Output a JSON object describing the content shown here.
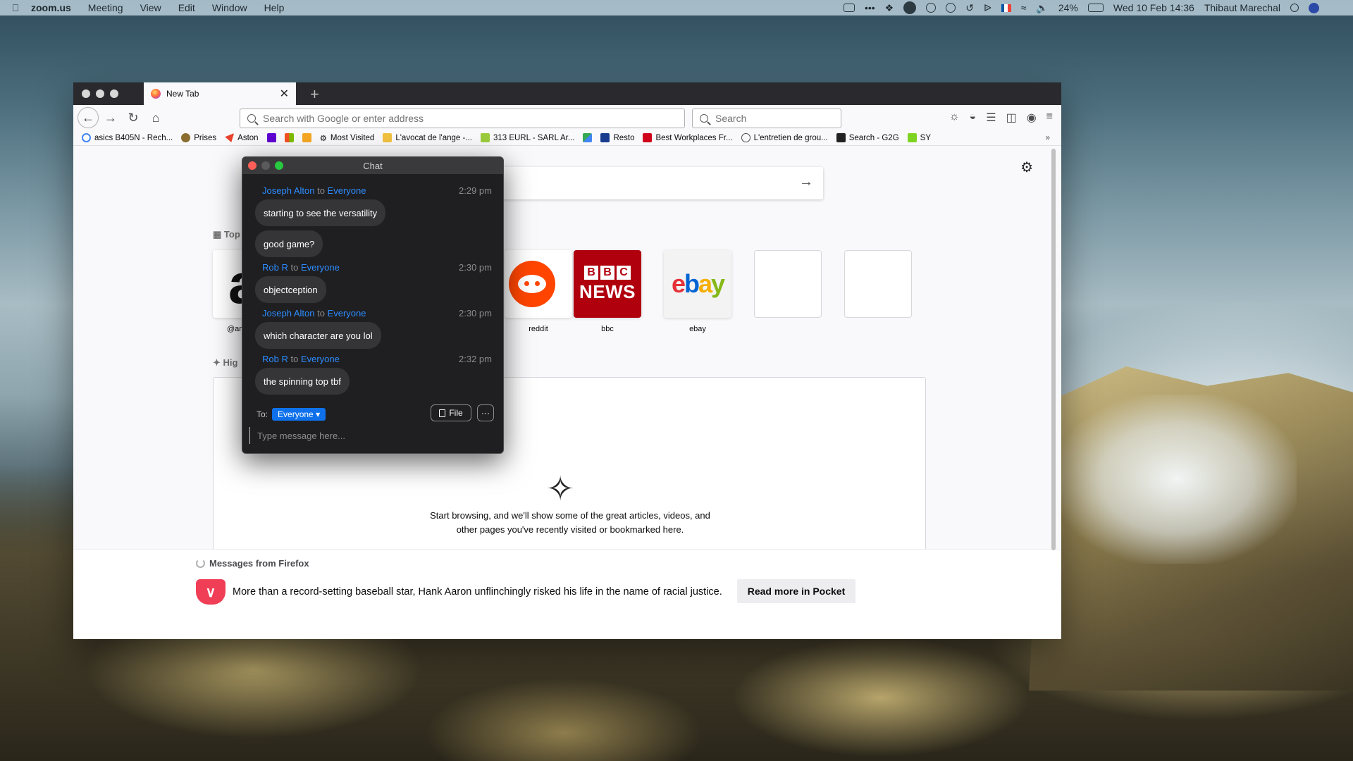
{
  "menubar": {
    "app": "zoom.us",
    "items": [
      "Meeting",
      "View",
      "Edit",
      "Window",
      "Help"
    ],
    "battery": "24%",
    "datetime": "Wed 10 Feb  14:36",
    "user": "Thibaut Marechal"
  },
  "firefox": {
    "tab_title": "New Tab",
    "url_placeholder": "Search with Google or enter address",
    "search_placeholder": "Search",
    "bookmarks": [
      {
        "label": "asics B405N - Rech...",
        "color": "#4285f4"
      },
      {
        "label": "Prises",
        "color": "#8a6d2f"
      },
      {
        "label": "Aston",
        "color": "#e8432d"
      },
      {
        "label": "",
        "color": "#5f01d1"
      },
      {
        "label": "",
        "color": "#f25022"
      },
      {
        "label": "",
        "color": "#f5a623"
      },
      {
        "label": "Most Visited",
        "color": "#4a4a4f"
      },
      {
        "label": "L'avocat de l'ange -...",
        "color": "#f0c040"
      },
      {
        "label": "313 EURL - SARL Ar...",
        "color": "#9ccc3c"
      },
      {
        "label": "",
        "color": "#34a853"
      },
      {
        "label": "Resto",
        "color": "#1a3c8f"
      },
      {
        "label": "Best Workplaces Fr...",
        "color": "#d0021b"
      },
      {
        "label": "L'entretien de grou...",
        "color": "#4a4a4f"
      },
      {
        "label": "Search - G2G",
        "color": "#222222"
      },
      {
        "label": "SY",
        "color": "#7ed321"
      }
    ],
    "top_sites": [
      {
        "label": "@am",
        "kind": "amazon"
      },
      {
        "label": "reddit",
        "kind": "reddit"
      },
      {
        "label": "bbc",
        "kind": "bbc"
      },
      {
        "label": "ebay",
        "kind": "ebay"
      },
      {
        "label": "",
        "kind": "empty"
      },
      {
        "label": "",
        "kind": "empty"
      }
    ],
    "section_top": "Top",
    "section_highlights": "Hig",
    "highlights_empty_text": "Start browsing, and we'll show some of the great articles, videos, and other pages you've recently visited or bookmarked here.",
    "messages_title": "Messages from Firefox",
    "message_text": "More than a record-setting baseball star, Hank Aaron unflinchingly risked his life in the name of racial justice.",
    "pocket_button": "Read more in Pocket",
    "bbc_letters": [
      "B",
      "B",
      "C"
    ],
    "bbc_news": "NEWS"
  },
  "chat": {
    "title": "Chat",
    "to_word": "to",
    "messages": [
      {
        "sender": "Joseph Alton",
        "recipient": "Everyone",
        "time": "2:29 pm",
        "text": "starting to see the versatility"
      },
      {
        "sender": "",
        "recipient": "",
        "time": "",
        "text": "good game?"
      },
      {
        "sender": "Rob R",
        "recipient": "Everyone",
        "time": "2:30 pm",
        "text": "objectception"
      },
      {
        "sender": "Joseph Alton",
        "recipient": "Everyone",
        "time": "2:30 pm",
        "text": "which character are you lol"
      },
      {
        "sender": "Rob R",
        "recipient": "Everyone",
        "time": "2:32 pm",
        "text": "the spinning top tbf"
      }
    ],
    "to_label": "To:",
    "to_value": "Everyone",
    "file_button": "File",
    "more_button": "···",
    "input_placeholder": "Type message here..."
  },
  "colors": {
    "zoom_blue": "#2d8cff",
    "everyone_pill": "#0e71eb",
    "pocket_red": "#ef3e56",
    "bbc_red": "#b0000e",
    "reddit_orange": "#ff4500"
  }
}
